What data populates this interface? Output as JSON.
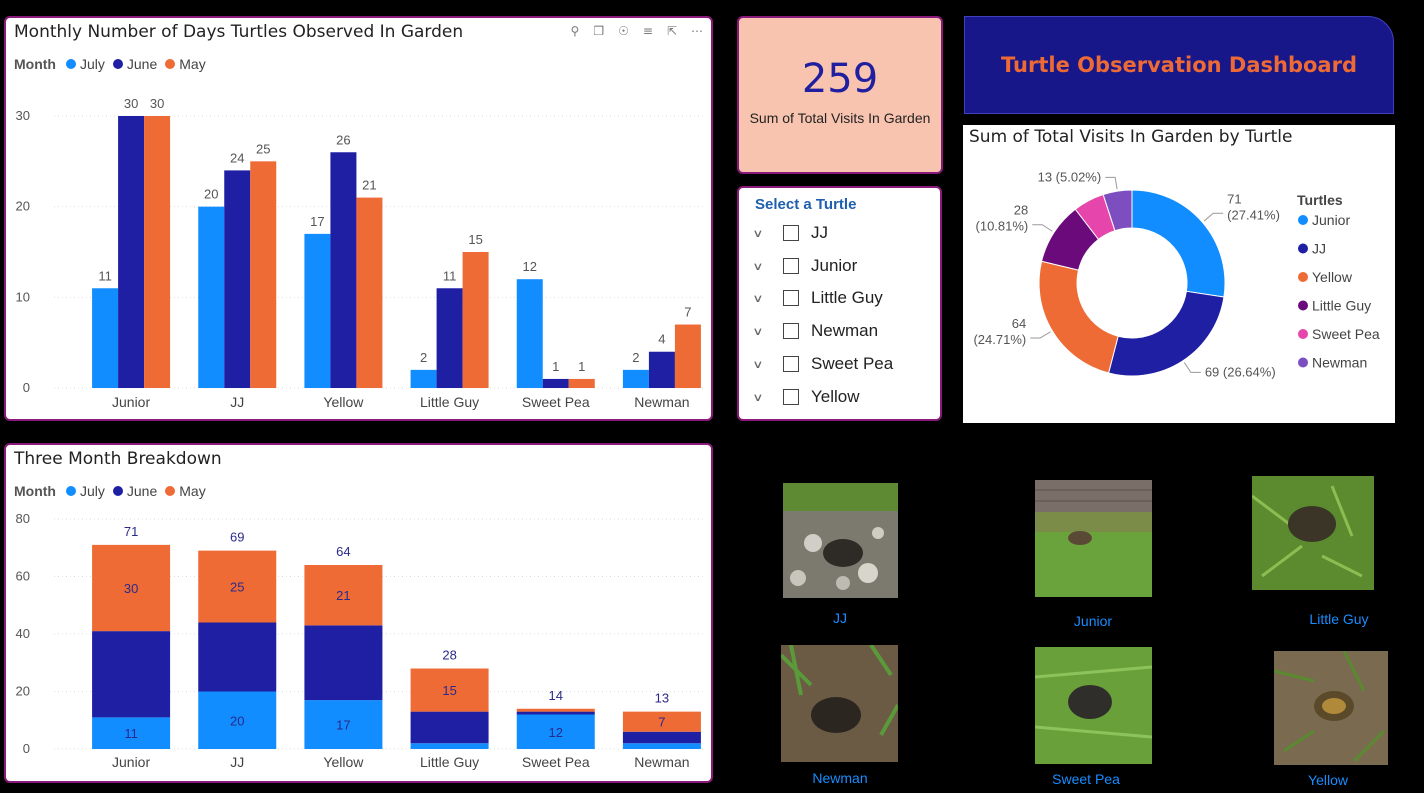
{
  "dashboard_title": "Turtle Observation Dashboard",
  "kpi": {
    "value": "259",
    "label": "Sum of Total Visits In Garden"
  },
  "slicer": {
    "title": "Select a Turtle",
    "items": [
      "JJ",
      "Junior",
      "Little Guy",
      "Newman",
      "Sweet Pea",
      "Yellow"
    ]
  },
  "legend": {
    "title": "Month",
    "items": [
      "July",
      "June",
      "May"
    ]
  },
  "donut_legend_title": "Turtles",
  "photos": {
    "labels": [
      "JJ",
      "Junior",
      "Little Guy",
      "Newman",
      "Sweet Pea",
      "Yellow"
    ]
  },
  "colors": {
    "july": "#118dff",
    "june": "#1f1fa3",
    "may": "#ef6b36",
    "border": "#8a1a7a"
  },
  "chart_data": [
    {
      "type": "bar",
      "title": "Monthly Number of Days Turtles Observed In Garden",
      "categories": [
        "Junior",
        "JJ",
        "Yellow",
        "Little Guy",
        "Sweet Pea",
        "Newman"
      ],
      "series": [
        {
          "name": "July",
          "values": [
            11,
            20,
            17,
            2,
            12,
            2
          ]
        },
        {
          "name": "June",
          "values": [
            30,
            24,
            26,
            11,
            1,
            4
          ]
        },
        {
          "name": "May",
          "values": [
            30,
            25,
            21,
            15,
            1,
            7
          ]
        }
      ],
      "ylim": [
        0,
        30
      ],
      "yticks": [
        0,
        10,
        20,
        30
      ],
      "grid": true,
      "legend_placement": "top-left"
    },
    {
      "type": "bar",
      "stacked": true,
      "title": "Three Month Breakdown",
      "categories": [
        "Junior",
        "JJ",
        "Yellow",
        "Little Guy",
        "Sweet Pea",
        "Newman"
      ],
      "series": [
        {
          "name": "July",
          "values": [
            11,
            20,
            17,
            2,
            12,
            2
          ]
        },
        {
          "name": "June",
          "values": [
            30,
            24,
            26,
            11,
            1,
            4
          ]
        },
        {
          "name": "May",
          "values": [
            30,
            25,
            21,
            15,
            1,
            7
          ]
        }
      ],
      "segment_labels": {
        "July": [
          "11",
          "20",
          "17",
          "",
          "12",
          ""
        ],
        "May": [
          "30",
          "25",
          "21",
          "15",
          "",
          "7"
        ]
      },
      "totals": [
        71,
        69,
        64,
        28,
        14,
        13
      ],
      "ylim": [
        0,
        80
      ],
      "yticks": [
        0,
        20,
        40,
        60,
        80
      ],
      "grid": true,
      "legend_placement": "top-left"
    },
    {
      "type": "pie",
      "donut": true,
      "title": "Sum of Total Visits In Garden by Turtle",
      "slices": [
        {
          "name": "Junior",
          "value": 71,
          "label": "71",
          "pct": "(27.41%)",
          "color": "#118dff"
        },
        {
          "name": "JJ",
          "value": 69,
          "label": "69 (26.64%)",
          "pct": "",
          "color": "#1f1fa3"
        },
        {
          "name": "Yellow",
          "value": 64,
          "label": "64",
          "pct": "(24.71%)",
          "color": "#ef6b36"
        },
        {
          "name": "Little Guy",
          "value": 28,
          "label": "28",
          "pct": "(10.81%)",
          "color": "#6b0a7a"
        },
        {
          "name": "Sweet Pea",
          "value": 14,
          "label": "",
          "pct": "",
          "color": "#e645ab"
        },
        {
          "name": "Newman",
          "value": 13,
          "label": "13 (5.02%)",
          "pct": "",
          "color": "#7c4ec0"
        }
      ],
      "legend_placement": "right"
    }
  ]
}
